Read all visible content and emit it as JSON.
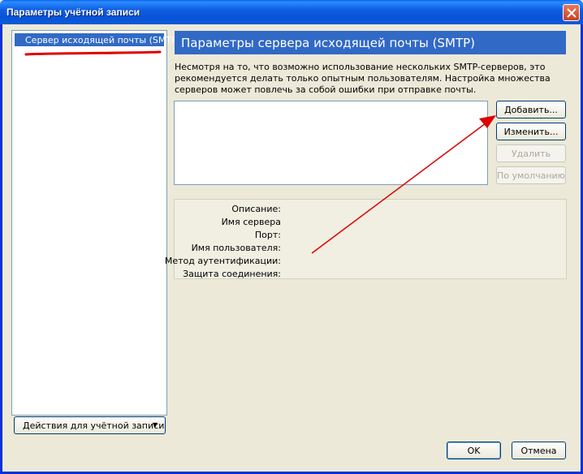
{
  "window": {
    "title": "Параметры учётной записи"
  },
  "sidebar": {
    "items": [
      {
        "label": "Сервер исходящей почты (SMTP)"
      }
    ],
    "actions_label": "Действия для учётной записи"
  },
  "main": {
    "header": "Параметры сервера исходящей почты (SMTP)",
    "description": "Несмотря на то, что возможно использование нескольких SMTP-серверов, это рекомендуется делать только опытным пользователям. Настройка множества серверов может повлечь за собой ошибки при отправке почты.",
    "buttons": {
      "add": "Добавить...",
      "edit": "Изменить...",
      "delete": "Удалить",
      "default": "По умолчанию"
    },
    "details": {
      "description": "Описание:",
      "server_name": "Имя сервера",
      "port": "Порт:",
      "username": "Имя пользователя:",
      "auth_method": "Метод аутентификации:",
      "security": "Защита соединения:"
    }
  },
  "footer": {
    "ok": "OK",
    "cancel": "Отмена"
  },
  "colors": {
    "titlebar": "#0a5fe0",
    "selection": "#316ac5",
    "annotation": "#e00000"
  }
}
